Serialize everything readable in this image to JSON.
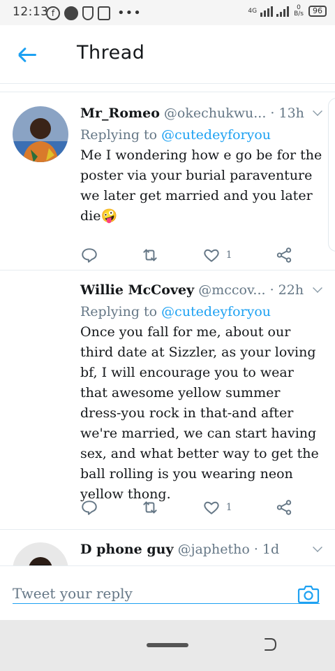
{
  "status_bar": {
    "time": "12:13",
    "network": "4G",
    "speed_value": "0",
    "speed_unit": "B/s",
    "battery": "96"
  },
  "header": {
    "title": "Thread",
    "back_icon": "arrow-left-icon"
  },
  "tweets": [
    {
      "name": "Mr_Romeo",
      "handle": "@okechukwu...",
      "time": "· 13h",
      "replying_label": "Replying to",
      "replying_to": "@cutedeyforyou",
      "text": "Me I wondering how e go be for the poster via your burial paraventure we later get married and you later die🤪",
      "likes": "1"
    },
    {
      "name": "Willie McCovey",
      "handle": "@mccov...",
      "time": "· 22h",
      "replying_label": "Replying to",
      "replying_to": "@cutedeyforyou",
      "text": "Once you fall for me, about our third date at Sizzler, as your loving bf, I will encourage you to wear that awesome yellow summer dress-you rock in that-and after we're married, we can start having sex, and what better way to get the ball rolling is you wearing neon yellow thong.",
      "likes": "1"
    },
    {
      "name": "D phone guy",
      "handle": "@japhetho",
      "time": "· 1d"
    }
  ],
  "composer": {
    "placeholder": "Tweet your reply",
    "camera_icon": "camera-icon"
  },
  "colors": {
    "accent": "#1da1f2",
    "text": "#14171a",
    "muted": "#657786",
    "divider": "#e6ecf0"
  }
}
